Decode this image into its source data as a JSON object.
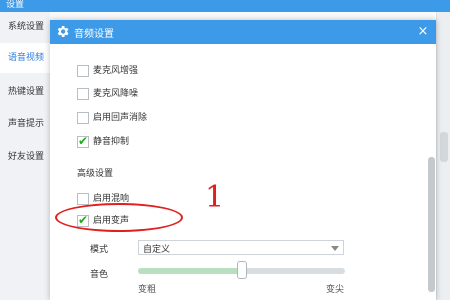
{
  "window": {
    "title": "设置"
  },
  "sidebar": {
    "items": [
      {
        "label": "系统设置",
        "active": false
      },
      {
        "label": "语音视频",
        "active": true
      },
      {
        "label": "热键设置",
        "active": false
      },
      {
        "label": "声音提示",
        "active": false
      },
      {
        "label": "好友设置",
        "active": false
      }
    ]
  },
  "dialog": {
    "title": "音频设置",
    "close_glyph": "×",
    "options": [
      {
        "label": "麦克风增强",
        "checked": false
      },
      {
        "label": "麦克风降噪",
        "checked": false
      },
      {
        "label": "启用回声消除",
        "checked": false
      },
      {
        "label": "静音抑制",
        "checked": true
      }
    ],
    "advanced_title": "高级设置",
    "advanced_options": [
      {
        "label": "启用混响",
        "checked": false
      },
      {
        "label": "启用变声",
        "checked": true
      }
    ],
    "mode": {
      "label": "模式",
      "value": "自定义"
    },
    "tone": {
      "label": "音色",
      "min_label": "变粗",
      "max_label": "变尖",
      "value": 0.5
    }
  },
  "annotation": {
    "number": "1"
  },
  "colors": {
    "title_blue": "#3d9ae8",
    "check_green": "#1aad19",
    "annotation_red": "#e01f1f",
    "slider_fill": "#b8e0c0"
  },
  "icons": [
    "gear-icon",
    "close-icon",
    "check-icon",
    "dropdown-arrow-icon"
  ]
}
